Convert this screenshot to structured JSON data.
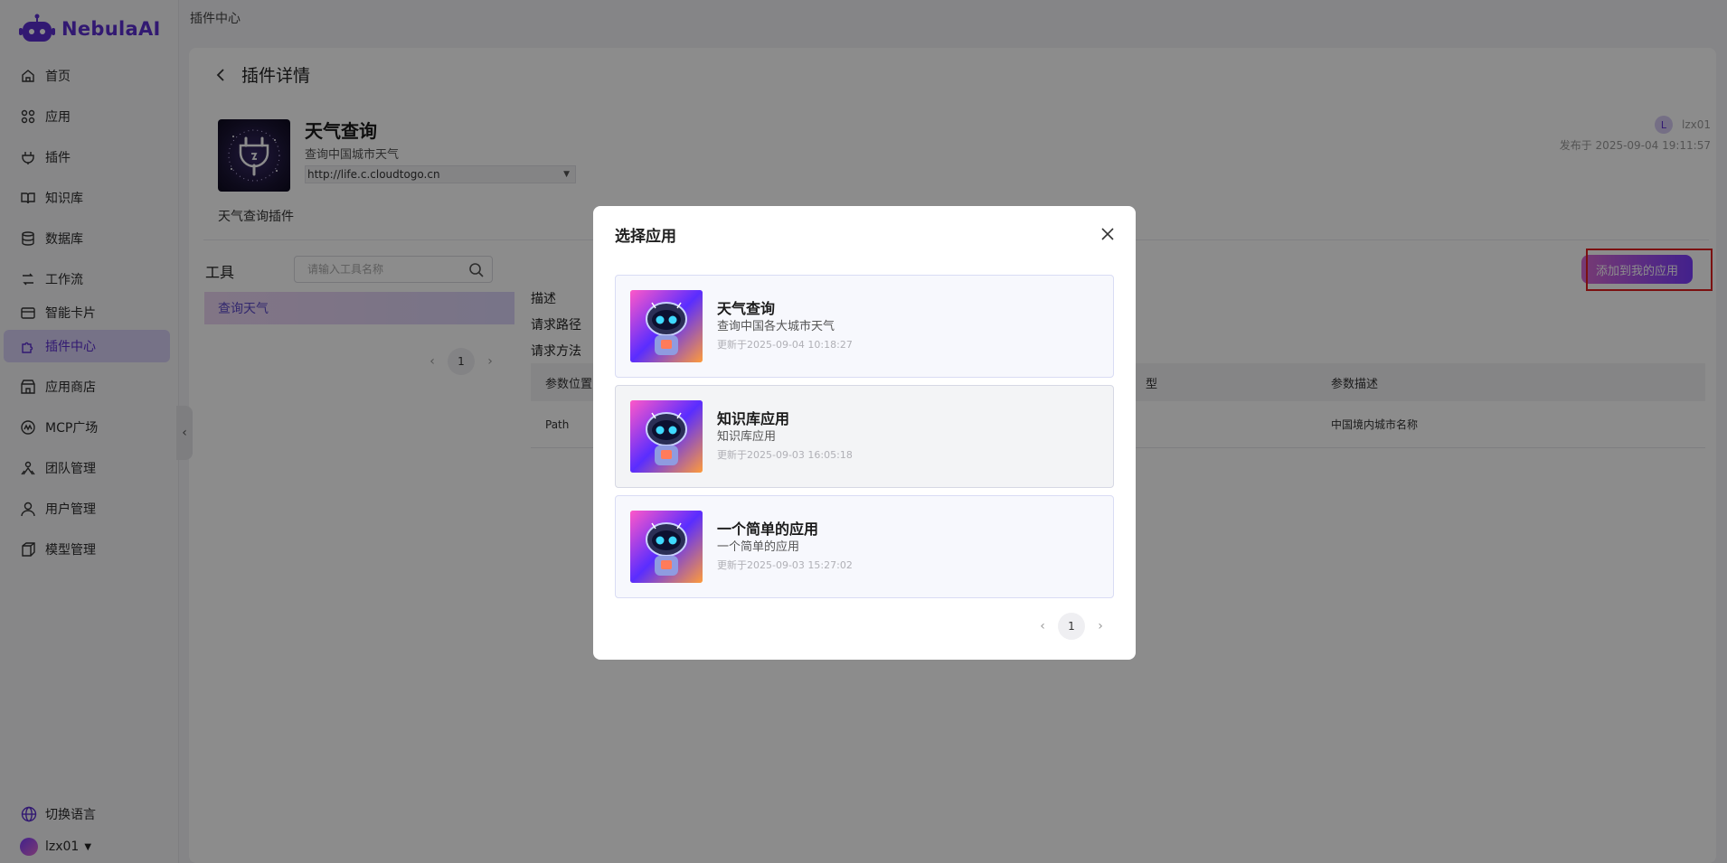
{
  "brand": {
    "name": "NebulaAI",
    "accent": "#5b2ecf"
  },
  "sidebar": {
    "items": [
      {
        "label": "首页",
        "icon": "home-icon"
      },
      {
        "label": "应用",
        "icon": "apps-grid-icon"
      },
      {
        "label": "插件",
        "icon": "plug-icon"
      },
      {
        "label": "知识库",
        "icon": "book-icon"
      },
      {
        "label": "数据库",
        "icon": "database-icon"
      },
      {
        "label": "工作流",
        "icon": "workflow-icon"
      },
      {
        "label": "智能卡片",
        "icon": "card-icon"
      },
      {
        "label": "插件中心",
        "icon": "puzzle-icon",
        "active": true
      },
      {
        "label": "应用商店",
        "icon": "store-icon"
      },
      {
        "label": "MCP广场",
        "icon": "mcp-icon"
      },
      {
        "label": "团队管理",
        "icon": "team-icon"
      },
      {
        "label": "用户管理",
        "icon": "user-icon"
      },
      {
        "label": "模型管理",
        "icon": "cube-icon"
      }
    ],
    "language_switch": "切换语言",
    "current_user": "lzx01"
  },
  "breadcrumb": "插件中心",
  "detail": {
    "header": "插件详情",
    "plugin_name": "天气查询",
    "plugin_desc": "查询中国城市天气",
    "plugin_url": "http://life.c.cloudtogo.cn",
    "plugin_intro": "天气查询插件",
    "publisher_initial": "L",
    "publisher_name": "lzx01",
    "published_at": "发布于 2025-09-04 19:11:57"
  },
  "tools": {
    "title": "工具",
    "search_placeholder": "请输入工具名称",
    "items": [
      "查询天气"
    ],
    "page": "1"
  },
  "tool_info": {
    "desc_label": "描述",
    "path_label": "请求路径",
    "method_label": "请求方法"
  },
  "param_table": {
    "headers": [
      "参数位置",
      "型",
      "参数描述"
    ],
    "rows": [
      [
        "Path",
        "",
        "中国境内城市名称"
      ]
    ]
  },
  "add_to_app_button": "添加到我的应用",
  "modal": {
    "title": "选择应用",
    "apps": [
      {
        "name": "天气查询",
        "desc": "查询中国各大城市天气",
        "updated": "更新于2025-09-04 10:18:27"
      },
      {
        "name": "知识库应用",
        "desc": "知识库应用",
        "updated": "更新于2025-09-03 16:05:18"
      },
      {
        "name": "一个简单的应用",
        "desc": "一个简单的应用",
        "updated": "更新于2025-09-03 15:27:02"
      }
    ],
    "page": "1"
  }
}
